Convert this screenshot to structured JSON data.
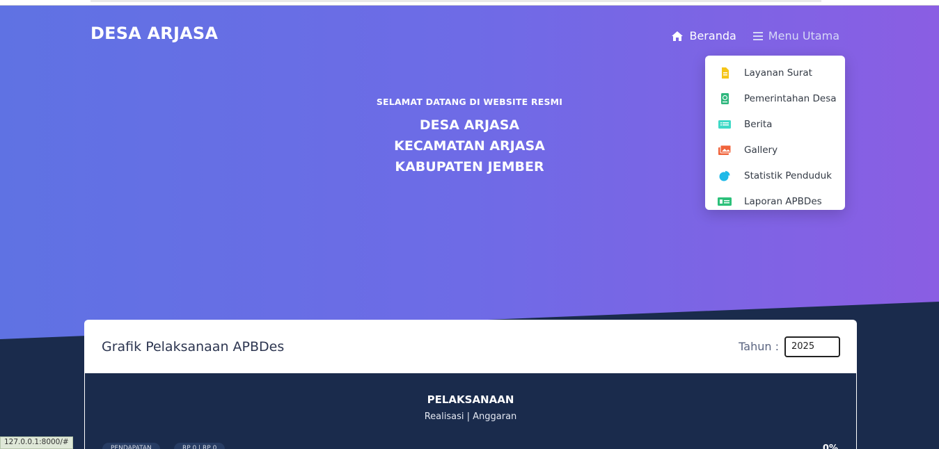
{
  "header": {
    "brand": "DESA ARJASA",
    "nav": {
      "home_label": "Beranda",
      "menu_label": "Menu Utama"
    }
  },
  "dropdown": {
    "items": [
      {
        "label": "Layanan Surat",
        "icon": "document-icon",
        "color": "#f5c518"
      },
      {
        "label": "Pemerintahan Desa",
        "icon": "globe-book-icon",
        "color": "#2eb67d"
      },
      {
        "label": "Berita",
        "icon": "news-icon",
        "color": "#3fd9c6"
      },
      {
        "label": "Gallery",
        "icon": "gallery-icon",
        "color": "#f0643c"
      },
      {
        "label": "Statistik Penduduk",
        "icon": "pie-chart-icon",
        "color": "#1fb9e8"
      },
      {
        "label": "Laporan APBDes",
        "icon": "money-icon",
        "color": "#2cc07a"
      }
    ]
  },
  "welcome": {
    "subtitle": "SELAMAT DATANG DI WEBSITE RESMI",
    "lines": [
      "DESA ARJASA",
      "KECAMATAN ARJASA",
      "KABUPATEN JEMBER"
    ]
  },
  "card": {
    "title": "Grafik Pelaksanaan APBDes",
    "year_label": "Tahun :",
    "year_value": "2025",
    "chart_title": "PELAKSANAAN",
    "chart_subtitle": "Realisasi | Anggaran",
    "pills": [
      "PENDAPATAN",
      "RP 0 | RP 0"
    ],
    "percent": "0%"
  },
  "status_bar": {
    "url": "127.0.0.1:8000/#"
  },
  "colors": {
    "hero_start": "#5f72e3",
    "hero_end": "#8a5ee3",
    "navy": "#1a2b4c"
  }
}
